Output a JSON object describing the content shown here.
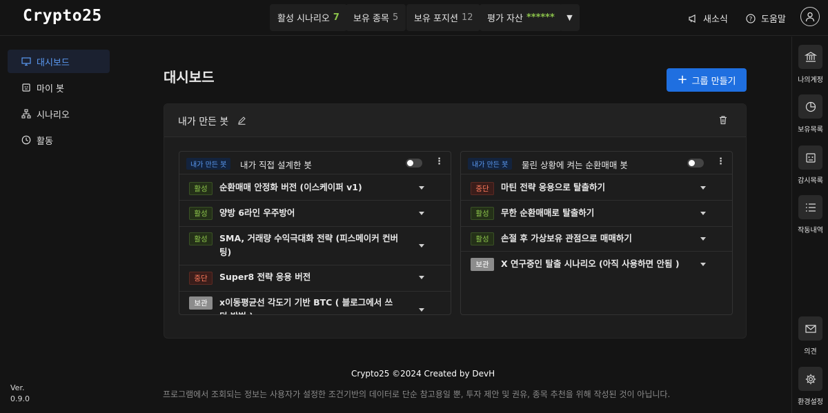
{
  "app": {
    "logo": "Crypto25"
  },
  "header": {
    "stats": [
      {
        "label": "활성 시나리오",
        "value": "7"
      },
      {
        "label": "보유 종목",
        "value": "5"
      },
      {
        "label": "보유 포지션",
        "value": "12"
      },
      {
        "label": "평가 자산",
        "value": "******"
      }
    ],
    "news": "새소식",
    "help": "도움말"
  },
  "sidebar": {
    "items": [
      {
        "label": "대시보드",
        "icon": "monitor-icon"
      },
      {
        "label": "마이 봇",
        "icon": "bot-icon"
      },
      {
        "label": "시나리오",
        "icon": "sitemap-icon"
      },
      {
        "label": "활동",
        "icon": "clock-icon"
      }
    ],
    "version_label": "Ver.",
    "version": "0.9.0"
  },
  "rightbar": {
    "items": [
      {
        "label": "나의계정",
        "icon": "bank-icon"
      },
      {
        "label": "보유목록",
        "icon": "pie-chart-icon"
      },
      {
        "label": "감시목록",
        "icon": "watch-icon"
      },
      {
        "label": "작동내역",
        "icon": "list-icon"
      },
      {
        "label": "의견",
        "icon": "mail-icon"
      },
      {
        "label": "환경설정",
        "icon": "gear-icon"
      }
    ]
  },
  "main": {
    "title": "대시보드",
    "create_group": "그룹 만들기",
    "group": {
      "title": "내가 만든 봇",
      "bots": [
        {
          "tag": "내가 만든 봇",
          "name": "내가 직접 설계한 봇",
          "enabled": false,
          "scenarios": [
            {
              "status": "활성",
              "type": "active",
              "name": "순환매매 안정화 버전 (이스케이퍼 v1)"
            },
            {
              "status": "활성",
              "type": "active",
              "name": "양방 6라인 우주방어"
            },
            {
              "status": "활성",
              "type": "active",
              "name": "SMA, 거래량 수익극대화 전략 (피스메이커 컨버팅)"
            },
            {
              "status": "중단",
              "type": "stop",
              "name": "Super8 전략 응용 버전"
            },
            {
              "status": "보관",
              "type": "keep",
              "name": "x이동평균선 각도기 기반 BTC ( 블로그에서 쓰던 방법 )"
            }
          ]
        },
        {
          "tag": "내가 만든 봇",
          "name": "물린 상황에 켜는 순환매매 봇",
          "enabled": false,
          "scenarios": [
            {
              "status": "중단",
              "type": "stop",
              "name": "마틴 전략 응용으로 탈출하기"
            },
            {
              "status": "활성",
              "type": "active",
              "name": "무한 순환매매로 탈출하기"
            },
            {
              "status": "활성",
              "type": "active",
              "name": "손절 후 가상보유 관점으로 매매하기"
            },
            {
              "status": "보관",
              "type": "keep",
              "name": "X 연구중인 탈출 시나리오 (아직 사용하면 안됨 )"
            }
          ]
        }
      ]
    }
  },
  "footer": {
    "credit": "Crypto25 ©2024 Created by DevH",
    "disclaimer": "프로그램에서 조회되는 정보는 사용자가 설정한 조건기반의 데이터로 단순 참고용일 뿐, 투자 제안 및 권유, 종목 추천을 위해 작성된 것이 아닙니다."
  }
}
